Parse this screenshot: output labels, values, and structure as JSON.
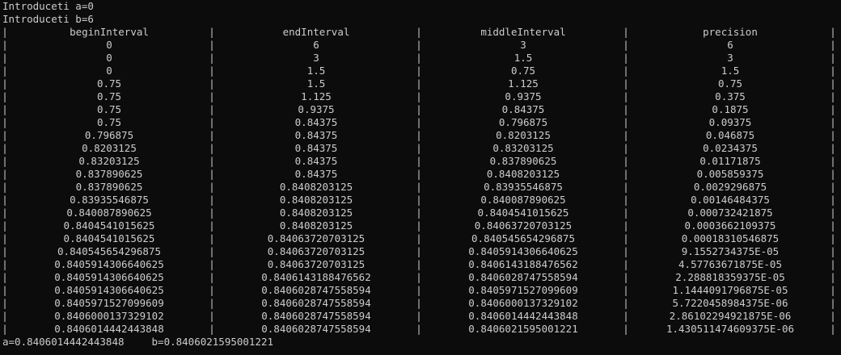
{
  "prompts": {
    "a": "Introduceti a=0",
    "b": "Introduceti b=6"
  },
  "separator": "|",
  "table": {
    "headers": [
      "beginInterval",
      "endInterval",
      "middleInterval",
      "precision"
    ],
    "rows": [
      [
        "0",
        "6",
        "3",
        "6"
      ],
      [
        "0",
        "3",
        "1.5",
        "3"
      ],
      [
        "0",
        "1.5",
        "0.75",
        "1.5"
      ],
      [
        "0.75",
        "1.5",
        "1.125",
        "0.75"
      ],
      [
        "0.75",
        "1.125",
        "0.9375",
        "0.375"
      ],
      [
        "0.75",
        "0.9375",
        "0.84375",
        "0.1875"
      ],
      [
        "0.75",
        "0.84375",
        "0.796875",
        "0.09375"
      ],
      [
        "0.796875",
        "0.84375",
        "0.8203125",
        "0.046875"
      ],
      [
        "0.8203125",
        "0.84375",
        "0.83203125",
        "0.0234375"
      ],
      [
        "0.83203125",
        "0.84375",
        "0.837890625",
        "0.01171875"
      ],
      [
        "0.837890625",
        "0.84375",
        "0.8408203125",
        "0.005859375"
      ],
      [
        "0.837890625",
        "0.8408203125",
        "0.83935546875",
        "0.0029296875"
      ],
      [
        "0.83935546875",
        "0.8408203125",
        "0.840087890625",
        "0.00146484375"
      ],
      [
        "0.840087890625",
        "0.8408203125",
        "0.8404541015625",
        "0.000732421875"
      ],
      [
        "0.8404541015625",
        "0.8408203125",
        "0.84063720703125",
        "0.0003662109375"
      ],
      [
        "0.8404541015625",
        "0.84063720703125",
        "0.840545654296875",
        "0.00018310546875"
      ],
      [
        "0.840545654296875",
        "0.84063720703125",
        "0.8405914306640625",
        "9.1552734375E-05"
      ],
      [
        "0.8405914306640625",
        "0.84063720703125",
        "0.8406143188476562",
        "4.57763671875E-05"
      ],
      [
        "0.8405914306640625",
        "0.8406143188476562",
        "0.8406028747558594",
        "2.288818359375E-05"
      ],
      [
        "0.8405914306640625",
        "0.8406028747558594",
        "0.8405971527099609",
        "1.1444091796875E-05"
      ],
      [
        "0.8405971527099609",
        "0.8406028747558594",
        "0.8406000137329102",
        "5.7220458984375E-06"
      ],
      [
        "0.8406000137329102",
        "0.8406028747558594",
        "0.8406014442443848",
        "2.86102294921875E-06"
      ],
      [
        "0.8406014442443848",
        "0.8406028747558594",
        "0.8406021595001221",
        "1.430511474609375E-06"
      ]
    ]
  },
  "result": {
    "a": "a=0.8406014442443848",
    "b": "b=0.8406021595001221"
  }
}
